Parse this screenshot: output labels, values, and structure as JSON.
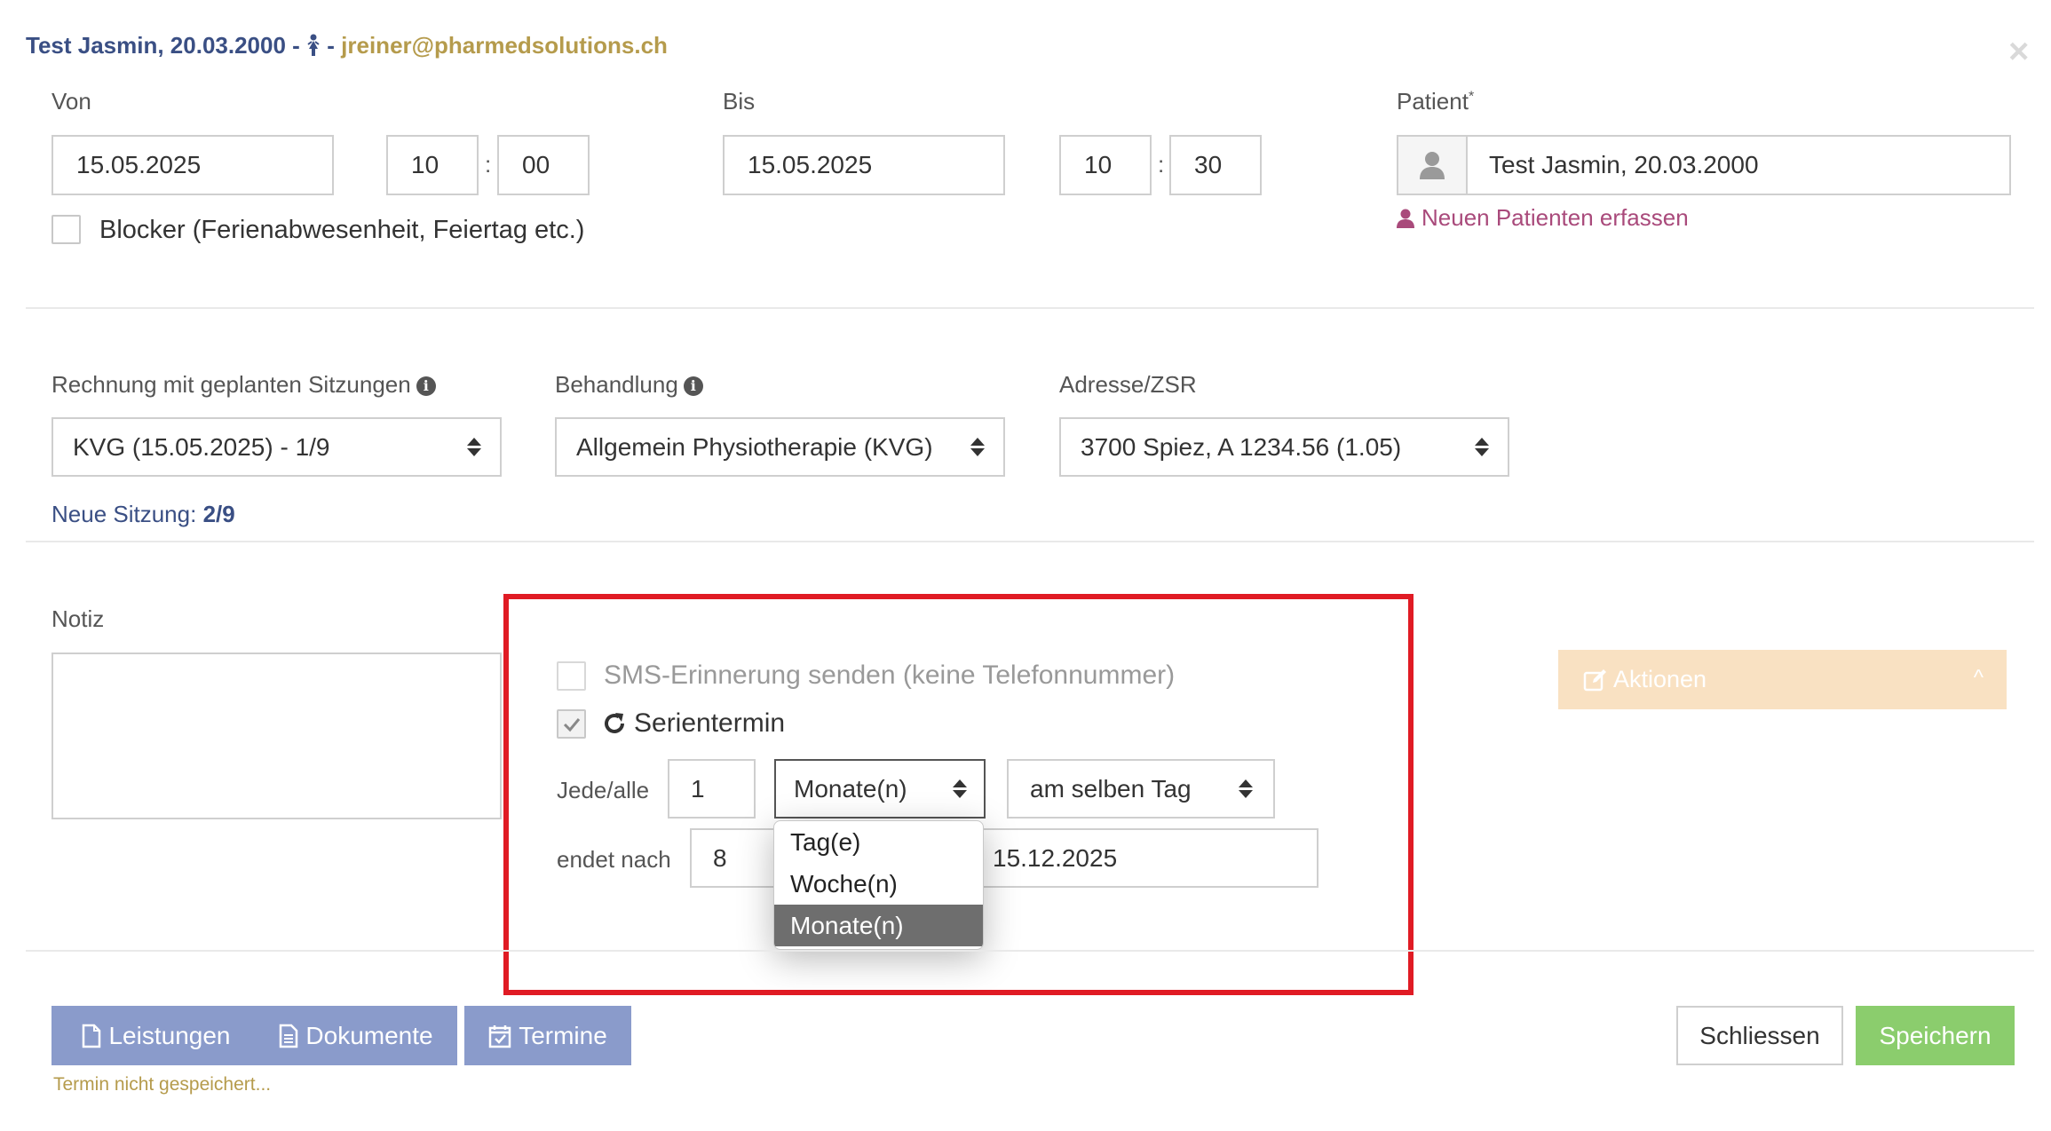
{
  "header": {
    "patient": "Test Jasmin, 20.03.2000",
    "separator1": " - ",
    "separator2": " - ",
    "email": "jreiner@pharmedsolutions.ch"
  },
  "close_label": "×",
  "von": {
    "label": "Von",
    "date": "15.05.2025",
    "hour": "10",
    "minute": "00"
  },
  "bis": {
    "label": "Bis",
    "date": "15.05.2025",
    "hour": "10",
    "minute": "30"
  },
  "time_separator": ":",
  "patient": {
    "label": "Patient",
    "required_mark": "*",
    "value": "Test Jasmin, 20.03.2000",
    "new_link": "Neuen Patienten erfassen"
  },
  "blocker": {
    "label": "Blocker (Ferienabwesenheit, Feiertag etc.)",
    "checked": false
  },
  "rechnung": {
    "label": "Rechnung mit geplanten Sitzungen",
    "value": "KVG (15.05.2025) - 1/9"
  },
  "behandlung": {
    "label": "Behandlung",
    "value": "Allgemein Physiotherapie (KVG)"
  },
  "adresse": {
    "label": "Adresse/ZSR",
    "value": "3700 Spiez, A 1234.56 (1.05)"
  },
  "neue_sitzung": {
    "label": "Neue Sitzung:",
    "value": "2/9"
  },
  "notiz": {
    "label": "Notiz",
    "value": ""
  },
  "sms": {
    "label": "SMS-Erinnerung senden (keine Telefonnummer)",
    "checked": false,
    "disabled": true
  },
  "serie": {
    "label": "Serientermin",
    "checked": true,
    "jede_label": "Jede/alle",
    "interval_value": "1",
    "unit_selected": "Monate(n)",
    "unit_options": [
      "Tag(e)",
      "Woche(n)",
      "Monate(n)"
    ],
    "day_option": "am selben Tag",
    "endet_label": "endet nach",
    "count_value": "8",
    "end_date": "15.12.2025"
  },
  "aktionen": {
    "label": "Aktionen",
    "chevron": "^"
  },
  "buttons": {
    "leistungen": "Leistungen",
    "dokumente": "Dokumente",
    "termine": "Termine",
    "schliessen": "Schliessen",
    "speichern": "Speichern"
  },
  "status": "Termin nicht gespeichert...",
  "colors": {
    "header_blue": "#3a4f84",
    "email_gold": "#b59b4c",
    "link_purple": "#a94a7b",
    "highlight_red": "#e01b24",
    "button_blue": "#8a9bcb",
    "button_green": "#8bcd6d",
    "aktionen_bg": "#f9e1c2"
  }
}
